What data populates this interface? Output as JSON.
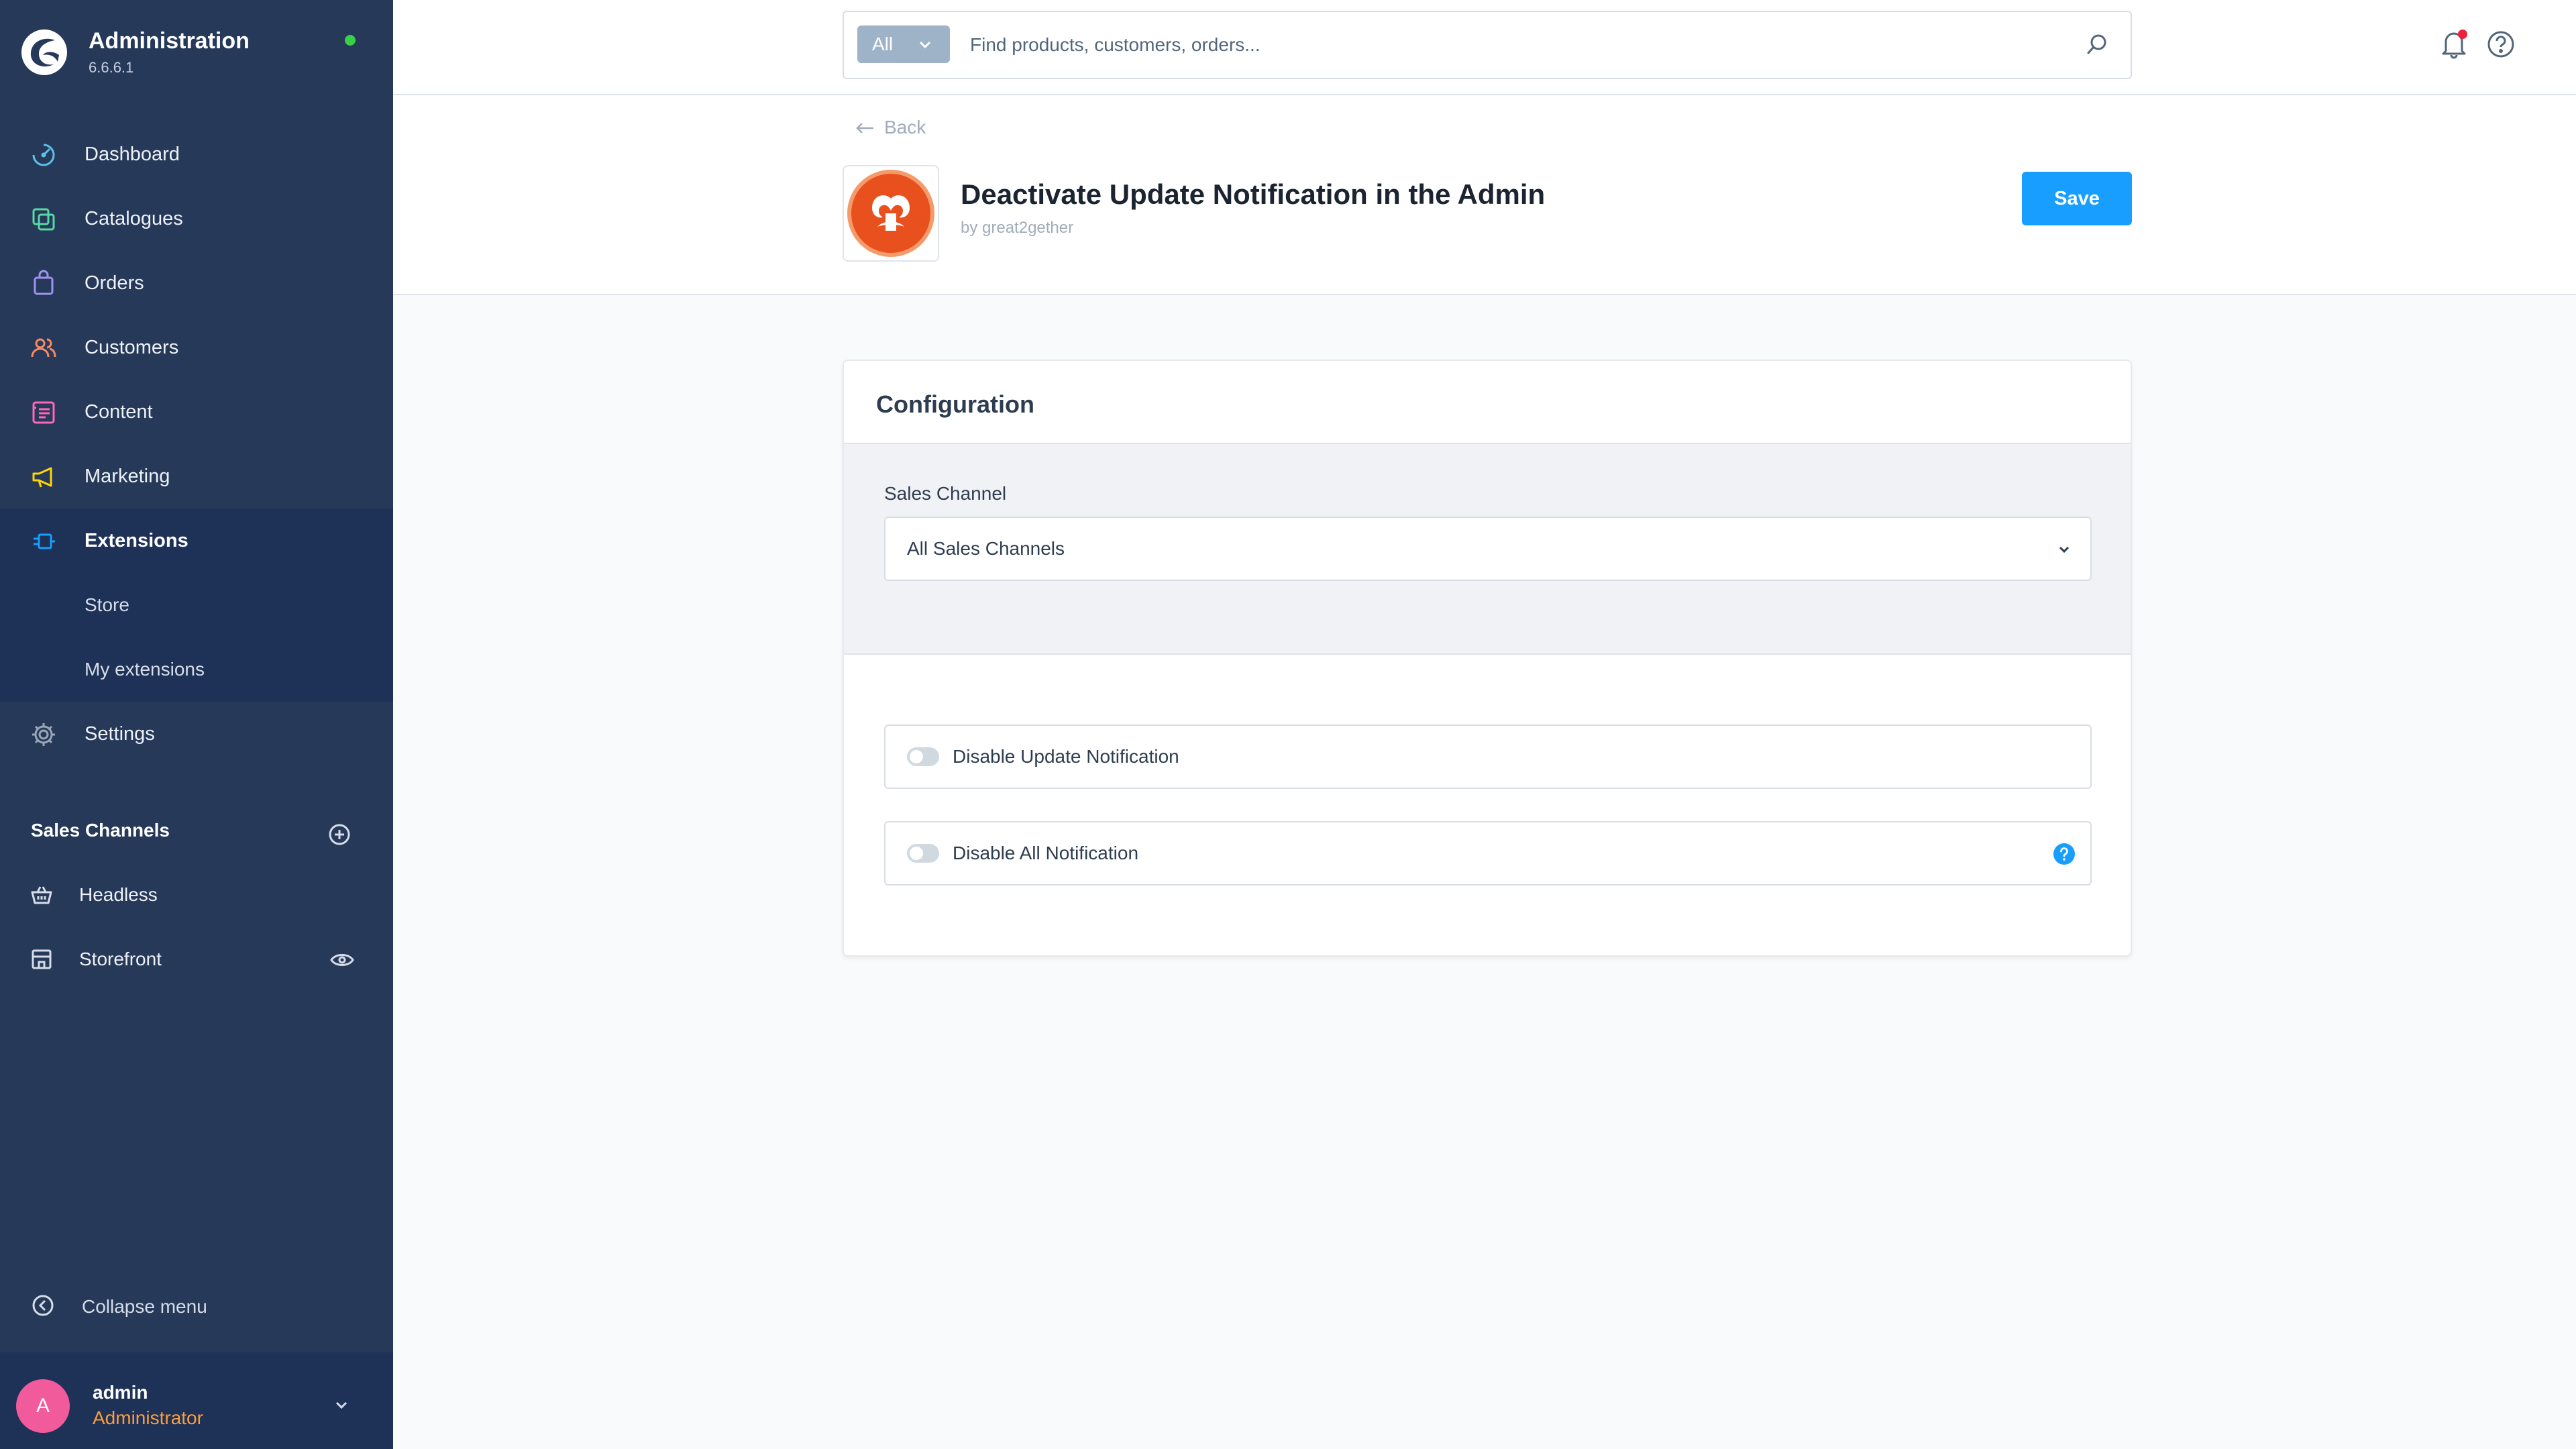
{
  "brand": {
    "title": "Administration",
    "version": "6.6.6.1"
  },
  "sidebar": {
    "items": [
      {
        "label": "Dashboard",
        "icon": "dashboard-icon",
        "color": "#5ec2e8"
      },
      {
        "label": "Catalogues",
        "icon": "catalogue-icon",
        "color": "#57d9a3"
      },
      {
        "label": "Orders",
        "icon": "orders-icon",
        "color": "#a092f0"
      },
      {
        "label": "Customers",
        "icon": "customers-icon",
        "color": "#f88962"
      },
      {
        "label": "Content",
        "icon": "content-icon",
        "color": "#ff68b4"
      },
      {
        "label": "Marketing",
        "icon": "marketing-icon",
        "color": "#ffd700"
      },
      {
        "label": "Extensions",
        "icon": "extensions-icon",
        "color": "#189eff"
      },
      {
        "label": "Settings",
        "icon": "settings-icon",
        "color": "#9aa8b5"
      }
    ],
    "extensions_sub": [
      "Store",
      "My extensions"
    ],
    "sales_channels_header": "Sales Channels",
    "sales_channels": [
      "Headless",
      "Storefront"
    ],
    "collapse_label": "Collapse menu"
  },
  "user": {
    "initial": "A",
    "name": "admin",
    "role": "Administrator"
  },
  "search": {
    "type_label": "All",
    "placeholder": "Find products, customers, orders..."
  },
  "header": {
    "back_label": "Back",
    "title": "Deactivate Update Notification in the Admin",
    "by": "by great2gether",
    "save_label": "Save"
  },
  "config": {
    "title": "Configuration",
    "sales_channel_label": "Sales Channel",
    "sales_channel_value": "All Sales Channels",
    "switches": [
      {
        "label": "Disable Update Notification",
        "enabled": false
      },
      {
        "label": "Disable All Notification",
        "enabled": false,
        "help": true
      }
    ]
  },
  "colors": {
    "primary": "#189eff",
    "sidebar": "#263959",
    "accent_status": "#37d046"
  }
}
